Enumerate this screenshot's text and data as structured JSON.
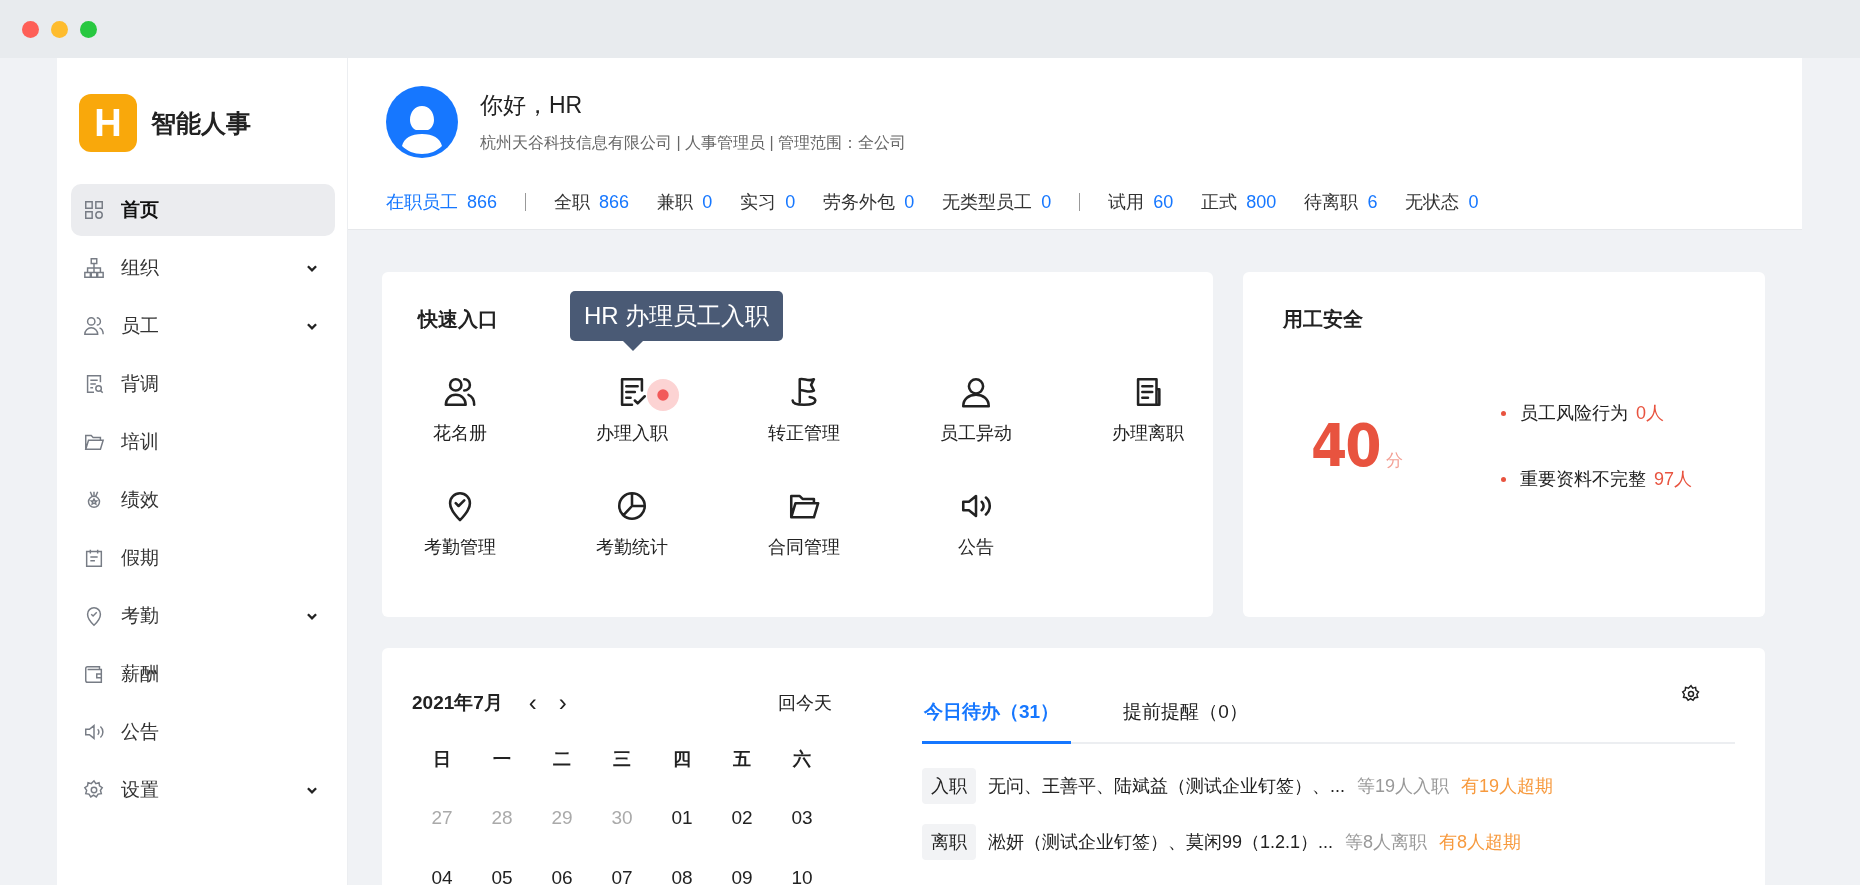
{
  "app": {
    "logo_letter": "H",
    "name": "智能人事"
  },
  "sidebar": {
    "items": [
      {
        "label": "首页",
        "kind": "grid",
        "selected": true,
        "expandable": false
      },
      {
        "label": "组织",
        "kind": "org",
        "selected": false,
        "expandable": true
      },
      {
        "label": "员工",
        "kind": "users",
        "selected": false,
        "expandable": true
      },
      {
        "label": "背调",
        "kind": "doc-search",
        "selected": false,
        "expandable": false
      },
      {
        "label": "培训",
        "kind": "folder",
        "selected": false,
        "expandable": false
      },
      {
        "label": "绩效",
        "kind": "medal",
        "selected": false,
        "expandable": false
      },
      {
        "label": "假期",
        "kind": "calendar",
        "selected": false,
        "expandable": false
      },
      {
        "label": "考勤",
        "kind": "pin-check",
        "selected": false,
        "expandable": true
      },
      {
        "label": "薪酬",
        "kind": "wallet",
        "selected": false,
        "expandable": false
      },
      {
        "label": "公告",
        "kind": "speaker",
        "selected": false,
        "expandable": false
      },
      {
        "label": "设置",
        "kind": "gear",
        "selected": false,
        "expandable": true
      }
    ]
  },
  "profile": {
    "greeting": "你好，HR",
    "subtitle": "杭州天谷科技信息有限公司 | 人事管理员 | 管理范围：全公司"
  },
  "stats": [
    [
      {
        "label": "在职员工",
        "value": "866",
        "selected": true
      }
    ],
    [
      {
        "label": "全职",
        "value": "866",
        "selected": false
      },
      {
        "label": "兼职",
        "value": "0",
        "selected": false
      },
      {
        "label": "实习",
        "value": "0",
        "selected": false
      },
      {
        "label": "劳务外包",
        "value": "0",
        "selected": false
      },
      {
        "label": "无类型员工",
        "value": "0",
        "selected": false
      }
    ],
    [
      {
        "label": "试用",
        "value": "60",
        "selected": false
      },
      {
        "label": "正式",
        "value": "800",
        "selected": false
      },
      {
        "label": "待离职",
        "value": "6",
        "selected": false
      },
      {
        "label": "无状态",
        "value": "0",
        "selected": false
      }
    ]
  ],
  "quick_entry": {
    "title": "快速入口",
    "items": [
      {
        "label": "花名册",
        "kind": "users",
        "hovered": false
      },
      {
        "label": "办理入职",
        "kind": "doc-check",
        "hovered": true,
        "tooltip": "HR 办理员工入职"
      },
      {
        "label": "转正管理",
        "kind": "flag",
        "hovered": false
      },
      {
        "label": "员工异动",
        "kind": "user",
        "hovered": false
      },
      {
        "label": "办理离职",
        "kind": "doc",
        "hovered": false
      },
      {
        "label": "考勤管理",
        "kind": "pin-check",
        "hovered": false
      },
      {
        "label": "考勤统计",
        "kind": "pie",
        "hovered": false
      },
      {
        "label": "合同管理",
        "kind": "folder",
        "hovered": false
      },
      {
        "label": "公告",
        "kind": "speaker",
        "hovered": false
      }
    ]
  },
  "safety": {
    "title": "用工安全",
    "score": "40",
    "unit": "分",
    "items": [
      {
        "label": "员工风险行为",
        "value": "0人"
      },
      {
        "label": "重要资料不完整",
        "value": "97人"
      }
    ]
  },
  "calendar": {
    "month": "2021年7月",
    "prev": "‹",
    "next": "›",
    "today_button": "回今天",
    "weekdays": [
      "日",
      "一",
      "二",
      "三",
      "四",
      "五",
      "六"
    ],
    "weeks": [
      [
        {
          "day": "27",
          "muted": true
        },
        {
          "day": "28",
          "muted": true
        },
        {
          "day": "29",
          "muted": true
        },
        {
          "day": "30",
          "muted": true
        },
        {
          "day": "01",
          "muted": false
        },
        {
          "day": "02",
          "muted": false
        },
        {
          "day": "03",
          "muted": false
        }
      ],
      [
        {
          "day": "04",
          "muted": false
        },
        {
          "day": "05",
          "muted": false
        },
        {
          "day": "06",
          "muted": false
        },
        {
          "day": "07",
          "muted": false
        },
        {
          "day": "08",
          "muted": false
        },
        {
          "day": "09",
          "muted": false
        },
        {
          "day": "10",
          "muted": false
        }
      ]
    ]
  },
  "todo": {
    "tabs": [
      {
        "label": "今日待办（31）",
        "selected": true
      },
      {
        "label": "提前提醒（0）",
        "selected": false
      }
    ],
    "rows": [
      {
        "tag": "入职",
        "names": "无问、王善平、陆斌益（测试企业钉签）、...",
        "count": "等19人入职",
        "overdue": "有19人超期"
      },
      {
        "tag": "离职",
        "names": "淞妍（测试企业钉签）、莫闲99（1.2.1）...",
        "count": "等8人离职",
        "overdue": "有8人超期"
      }
    ]
  }
}
